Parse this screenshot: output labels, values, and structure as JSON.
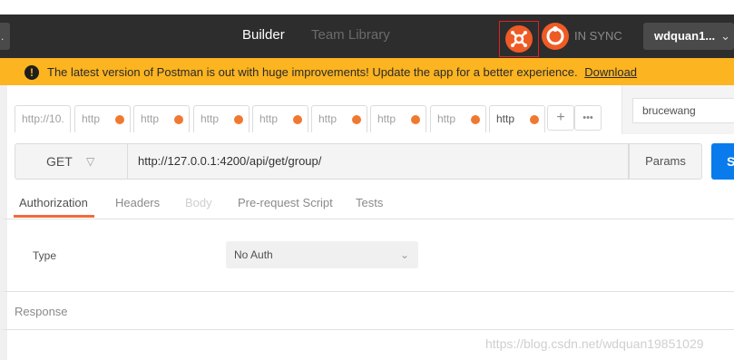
{
  "header": {
    "left_stub": ".",
    "tabs": [
      {
        "label": "Builder",
        "active": true
      },
      {
        "label": "Team Library",
        "active": false
      }
    ],
    "icons": {
      "capture": "satellite-icon",
      "sync": "sync-icon"
    },
    "sync_status": "IN SYNC",
    "user": "wdquan1..."
  },
  "banner": {
    "icon": "warning-icon",
    "message": "The latest version of Postman is out with huge improvements! Update the app for a better experience.",
    "link": "Download",
    "color": "#fcb420"
  },
  "request_tabs": [
    {
      "label": "http://10.",
      "dot": false
    },
    {
      "label": "http",
      "dot": true
    },
    {
      "label": "http",
      "dot": true
    },
    {
      "label": "http",
      "dot": true
    },
    {
      "label": "http",
      "dot": true
    },
    {
      "label": "http",
      "dot": true
    },
    {
      "label": "http",
      "dot": true
    },
    {
      "label": "http",
      "dot": true
    },
    {
      "label": "http",
      "dot": true,
      "active": true
    }
  ],
  "tab_actions": {
    "add": "+",
    "more": "•••"
  },
  "environment": {
    "selected": "brucewang"
  },
  "request": {
    "method": "GET",
    "url": "http://127.0.0.1:4200/api/get/group/",
    "params_label": "Params",
    "send_label": "Se",
    "accent": "#097bed"
  },
  "subtabs": [
    {
      "label": "Authorization",
      "state": "active"
    },
    {
      "label": "Headers",
      "state": "normal"
    },
    {
      "label": "Body",
      "state": "disabled"
    },
    {
      "label": "Pre-request Script",
      "state": "normal"
    },
    {
      "label": "Tests",
      "state": "normal"
    }
  ],
  "auth": {
    "type_label": "Type",
    "type_value": "No Auth"
  },
  "response": {
    "label": "Response"
  },
  "watermark": "https://blog.csdn.net/wdquan19851029"
}
